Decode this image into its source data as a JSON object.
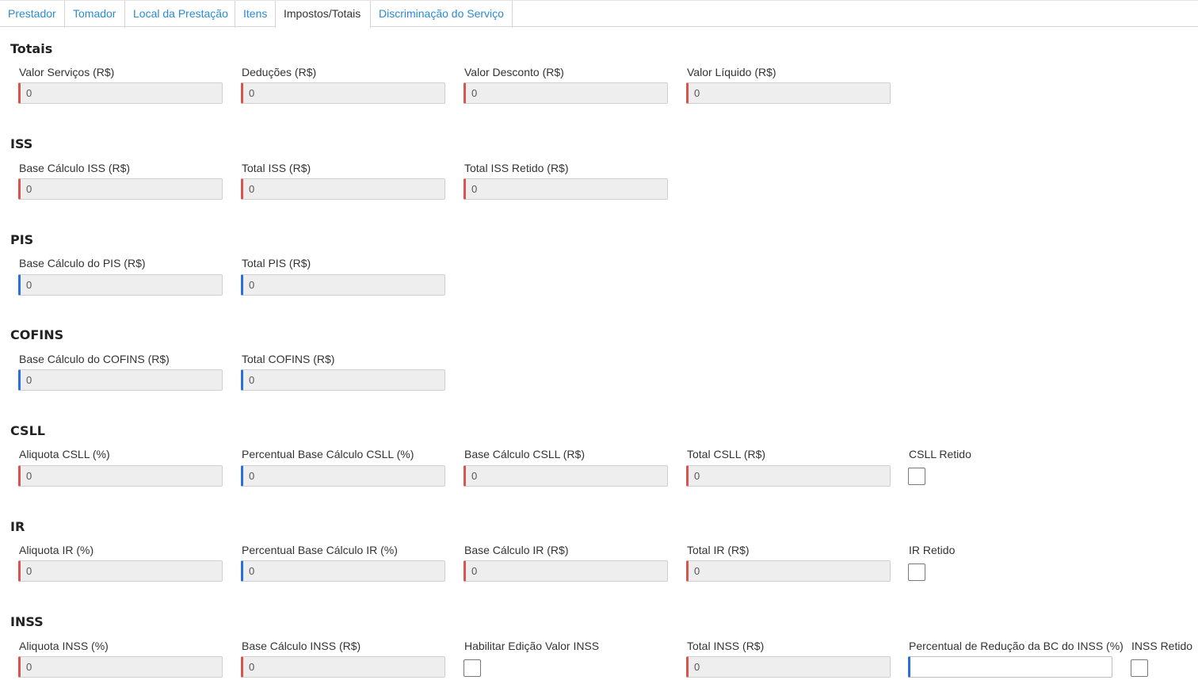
{
  "tabs": [
    "Prestador",
    "Tomador",
    "Local da Prestação",
    "Itens",
    "Impostos/Totais",
    "Discriminação do Serviço"
  ],
  "sections": {
    "totais": {
      "title": "Totais",
      "valor_servicos": {
        "label": "Valor Serviços (R$)",
        "value": "0"
      },
      "deducoes": {
        "label": "Deduções (R$)",
        "value": "0"
      },
      "valor_desconto": {
        "label": "Valor Desconto (R$)",
        "value": "0"
      },
      "valor_liquido": {
        "label": "Valor Líquido (R$)",
        "value": "0"
      }
    },
    "iss": {
      "title": "ISS",
      "base_calculo": {
        "label": "Base Cálculo ISS (R$)",
        "value": "0"
      },
      "total": {
        "label": "Total ISS (R$)",
        "value": "0"
      },
      "total_retido": {
        "label": "Total ISS Retido (R$)",
        "value": "0"
      }
    },
    "pis": {
      "title": "PIS",
      "base_calculo": {
        "label": "Base Cálculo do PIS (R$)",
        "value": "0"
      },
      "total": {
        "label": "Total PIS (R$)",
        "value": "0"
      }
    },
    "cofins": {
      "title": "COFINS",
      "base_calculo": {
        "label": "Base Cálculo do COFINS (R$)",
        "value": "0"
      },
      "total": {
        "label": "Total COFINS (R$)",
        "value": "0"
      }
    },
    "csll": {
      "title": "CSLL",
      "aliquota": {
        "label": "Aliquota CSLL (%)",
        "value": "0"
      },
      "percentual_base": {
        "label": "Percentual Base Cálculo CSLL (%)",
        "value": "0"
      },
      "base_calculo": {
        "label": "Base Cálculo CSLL (R$)",
        "value": "0"
      },
      "total": {
        "label": "Total CSLL (R$)",
        "value": "0"
      },
      "retido": {
        "label": "CSLL Retido"
      }
    },
    "ir": {
      "title": "IR",
      "aliquota": {
        "label": "Aliquota IR (%)",
        "value": "0"
      },
      "percentual_base": {
        "label": "Percentual Base Cálculo IR (%)",
        "value": "0"
      },
      "base_calculo": {
        "label": "Base Cálculo IR (R$)",
        "value": "0"
      },
      "total": {
        "label": "Total IR (R$)",
        "value": "0"
      },
      "retido": {
        "label": "IR Retido"
      }
    },
    "inss": {
      "title": "INSS",
      "aliquota": {
        "label": "Aliquota INSS (%)",
        "value": "0"
      },
      "base_calculo": {
        "label": "Base Cálculo INSS (R$)",
        "value": "0"
      },
      "habilitar_edicao": {
        "label": "Habilitar Edição Valor INSS"
      },
      "total": {
        "label": "Total INSS (R$)",
        "value": "0"
      },
      "percentual_reducao": {
        "label": "Percentual de Redução da BC do INSS (%)",
        "value": ""
      },
      "retido": {
        "label": "INSS Retido"
      }
    }
  },
  "colors": {
    "tab_link": "#2b8ad0",
    "required_border": "#d9534f",
    "optional_border": "#2a6fdb",
    "readonly_bg": "#eeeeee"
  }
}
